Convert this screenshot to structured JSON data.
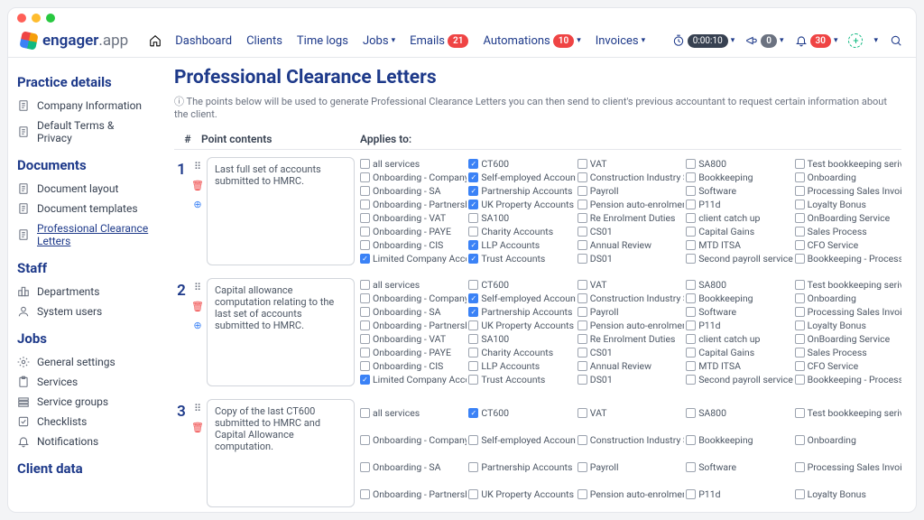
{
  "logo": {
    "brand": "engager",
    "suffix": ".app"
  },
  "nav": {
    "dashboard": "Dashboard",
    "clients": "Clients",
    "timelogs": "Time logs",
    "jobs": "Jobs",
    "emails": "Emails",
    "emails_badge": "21",
    "automations": "Automations",
    "automations_badge": "10",
    "invoices": "Invoices",
    "timer": "0:00:10",
    "announce_badge": "0",
    "bell_badge": "30"
  },
  "sidebar": {
    "s1": "Practice details",
    "s1_items": [
      "Company Information",
      "Default Terms & Privacy"
    ],
    "s2": "Documents",
    "s2_items": [
      "Document layout",
      "Document templates",
      "Professional Clearance Letters"
    ],
    "s3": "Staff",
    "s3_items": [
      "Departments",
      "System users"
    ],
    "s4": "Jobs",
    "s4_items": [
      "General settings",
      "Services",
      "Service groups",
      "Checklists",
      "Notifications"
    ],
    "s5": "Client data"
  },
  "page": {
    "title": "Professional Clearance Letters",
    "info": "ⓘ The points below will be used to generate Professional Clearance Letters you can then send to client's previous accountant to request certain information about the client.",
    "th_num": "#",
    "th_content": "Point contents",
    "th_applies": "Applies to:"
  },
  "services": [
    [
      "all services",
      "CT600",
      "VAT",
      "SA800",
      "Test bookkeeping serivce"
    ],
    [
      "Onboarding - Company",
      "Self-employed Accounts",
      "Construction Industry Scheme",
      "Bookkeeping",
      "Onboarding"
    ],
    [
      "Onboarding - SA",
      "Partnership Accounts",
      "Payroll",
      "Software",
      "Processing Sales Invoices"
    ],
    [
      "Onboarding - Partnership",
      "UK Property Accounts",
      "Pension auto-enrolment",
      "P11d",
      "Loyalty Bonus"
    ],
    [
      "Onboarding - VAT",
      "SA100",
      "Re Enrolment Duties",
      "client catch up",
      "OnBoarding Service"
    ],
    [
      "Onboarding - PAYE",
      "Charity Accounts",
      "CS01",
      "Capital Gains",
      "Sales Process"
    ],
    [
      "Onboarding - CIS",
      "LLP Accounts",
      "Annual Review",
      "MTD ITSA",
      "CFO Service"
    ],
    [
      "Limited Company Accounts",
      "Trust Accounts",
      "DS01",
      "Second payroll service",
      "Bookkeeping - Processing Dext"
    ]
  ],
  "points": [
    {
      "num": "1",
      "text": "Last full set of accounts submitted to HMRC.",
      "checked": [
        "CT600",
        "Self-employed Accounts",
        "Partnership Accounts",
        "UK Property Accounts",
        "LLP Accounts",
        "Limited Company Accounts",
        "Trust Accounts"
      ]
    },
    {
      "num": "2",
      "text": "Capital allowance computation relating to the last set of accounts submitted to HMRC.",
      "checked": [
        "Self-employed Accounts",
        "Partnership Accounts",
        "Limited Company Accounts"
      ]
    },
    {
      "num": "3",
      "text": "Copy of the last CT600 submitted to HMRC and Capital Allowance computation.",
      "checked": [
        "CT600"
      ],
      "partial": true
    }
  ]
}
